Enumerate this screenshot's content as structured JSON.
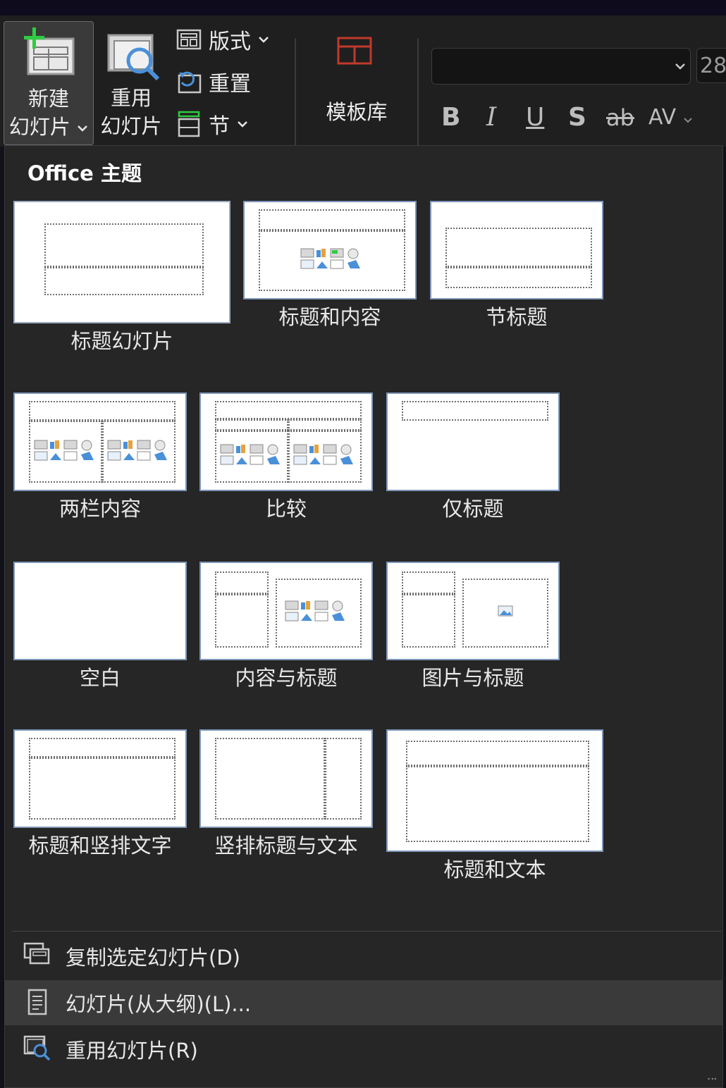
{
  "ribbon": {
    "new_slide": {
      "line1": "新建",
      "line2": "幻灯片",
      "caret": "⌄"
    },
    "reuse_slide": {
      "line1": "重用",
      "line2": "幻灯片"
    },
    "layout_label": "版式",
    "reset_label": "重置",
    "section_label": "节",
    "template_gallery_label": "模板库",
    "font_name": "",
    "font_size": "28",
    "format_buttons": {
      "bold": "B",
      "italic": "I",
      "underline": "U",
      "shadow": "S",
      "strikethrough": "ab",
      "spacing": "AV"
    },
    "accent_color": "#c0392b",
    "new_slide_plus_color": "#2ecc40"
  },
  "dropdown": {
    "section_title": "Office 主题",
    "layouts": [
      {
        "label": "标题幻灯片",
        "icon": "title-slide-layout"
      },
      {
        "label": "标题和内容",
        "icon": "title-content-layout"
      },
      {
        "label": "节标题",
        "icon": "section-header-layout"
      },
      {
        "label": "两栏内容",
        "icon": "two-content-layout"
      },
      {
        "label": "比较",
        "icon": "comparison-layout"
      },
      {
        "label": "仅标题",
        "icon": "title-only-layout"
      },
      {
        "label": "空白",
        "icon": "blank-layout"
      },
      {
        "label": "内容与标题",
        "icon": "content-caption-layout"
      },
      {
        "label": "图片与标题",
        "icon": "picture-caption-layout"
      },
      {
        "label": "标题和竖排文字",
        "icon": "title-vertical-text-layout"
      },
      {
        "label": "竖排标题与文本",
        "icon": "vertical-title-text-layout"
      },
      {
        "label": "标题和文本",
        "icon": "title-text-layout"
      }
    ],
    "menu_items": [
      {
        "label": "复制选定幻灯片(D)",
        "icon": "duplicate-slides-icon"
      },
      {
        "label": "幻灯片(从大纲)(L)...",
        "icon": "outline-icon"
      },
      {
        "label": "重用幻灯片(R)",
        "icon": "reuse-slides-icon"
      }
    ]
  }
}
